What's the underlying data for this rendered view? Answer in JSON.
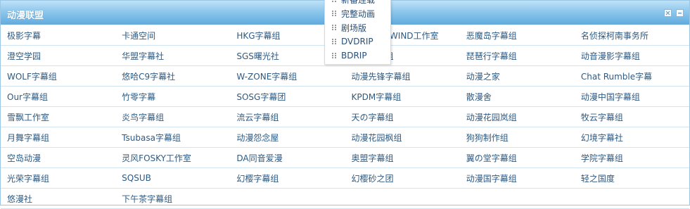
{
  "panel": {
    "title": "动漫联盟"
  },
  "header_buttons": [
    {
      "icon": "close-icon"
    },
    {
      "icon": "minimize-icon"
    }
  ],
  "groups": [
    [
      "极影字幕",
      "卡通空间",
      "HKG字幕组",
      "风之FREEWIND工作室",
      "恶魔岛字幕组",
      "名侦探柯南事务所"
    ],
    [
      "澄空学园",
      "华盟字幕社",
      "SGS曙光社",
      "漫游字幕组",
      "琵琶行字幕组",
      "动音漫影字幕组"
    ],
    [
      "WOLF字幕组",
      "悠哈C9字幕社",
      "W-ZONE字幕组",
      "动漫先锋字幕组",
      "动漫之家",
      "Chat Rumble字幕"
    ],
    [
      "Our字幕组",
      "竹零字幕",
      "SOSG字幕团",
      "KPDM字幕组",
      "散漫舍",
      "动漫中国字幕组"
    ],
    [
      "雪飘工作室",
      "炎鸟字幕组",
      "流云字幕组",
      "天の字幕组",
      "动漫花园岚组",
      "牧云字幕组"
    ],
    [
      "月舞字幕组",
      "Tsubasa字幕组",
      "动漫怨念屋",
      "动漫花园枫组",
      "狗狗制作组",
      "幻境字幕社"
    ],
    [
      "空岛动漫",
      "灵风FOSKY工作室",
      "DA同音爱漫",
      "奥盟字幕组",
      "翼の堂字幕组",
      "学院字幕组"
    ],
    [
      "光荣字幕组",
      "SQSUB",
      "幻樱字幕组",
      "幻樱砂之团",
      "动漫国字幕组",
      "轻之国度"
    ],
    [
      "悠漫社",
      "下午茶字幕组",
      "",
      "",
      "",
      ""
    ]
  ],
  "dropdown": {
    "items": [
      "新番连载",
      "完整动画",
      "剧场版",
      "DVDRIP",
      "BDRIP"
    ]
  }
}
